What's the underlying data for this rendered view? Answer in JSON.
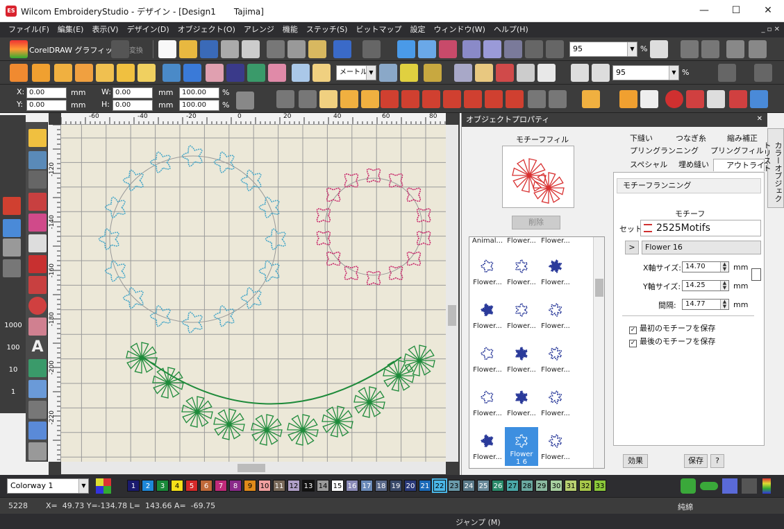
{
  "window": {
    "title": "Wilcom EmbroideryStudio - デザイン - [Design1",
    "machine": "Tajima]",
    "min": "—",
    "max": "☐",
    "close": "✕"
  },
  "menu": [
    "ファイル(F)",
    "編集(E)",
    "表示(V)",
    "デザイン(D)",
    "オブジェクト(O)",
    "アレンジ",
    "機能",
    "ステッチ(S)",
    "ビットマップ",
    "設定",
    "ウィンドウ(W)",
    "ヘルプ(H)"
  ],
  "menu_right": "_ ▫ ✕",
  "toolbar1": {
    "coreldraw_label": "CorelDRAW グラフィック",
    "convert_label": "変換",
    "zoom_value": "95",
    "zoom_unit": "%"
  },
  "toolbar2": {
    "method_combo": "メートル法",
    "zoom2_value": "95",
    "zoom2_unit": "%"
  },
  "toolbar3": {
    "x_label": "X:",
    "x_value": "0.00",
    "y_label": "Y:",
    "y_value": "0.00",
    "w_label": "W:",
    "w_value": "0.00",
    "h_label": "H:",
    "h_value": "0.00",
    "unit": "mm",
    "scale_w": "100.00",
    "scale_h": "100.00",
    "pct": "%"
  },
  "ruler": {
    "top": [
      "-60",
      "-40",
      "-20",
      "0",
      "20",
      "40",
      "60",
      "80"
    ],
    "left": [
      "-120",
      "-140",
      "-160",
      "-180",
      "-200",
      "-220"
    ]
  },
  "left_tools": {
    "labels": [
      "1000",
      "100",
      "10",
      "1"
    ]
  },
  "props": {
    "title": "オブジェクトプロパティ",
    "preview_label": "モチーフフィル",
    "delete_button": "削除",
    "tabs": [
      "下縫い",
      "つなぎ糸",
      "縮み補正",
      "プリングランニング",
      "プリングフィル",
      "スペシャル",
      "埋め縫い",
      "アウトライン"
    ],
    "section_title": "モチーフランニング",
    "motif_heading": "モチーフ",
    "set_label": "セット:",
    "set_value": "2525Motifs",
    "expand": ">",
    "motif_value": "Flower 16",
    "x_size_label": "X軸サイズ:",
    "x_size": "14.70",
    "y_size_label": "Y軸サイズ:",
    "y_size": "14.25",
    "spacing_label": "間隔:",
    "spacing": "14.77",
    "unit": "mm",
    "keep_first": "最初のモチーフを保存",
    "keep_last": "最後のモチーフを保存",
    "effects_button": "効果",
    "save_button": "保存",
    "help_button": "?",
    "side_tab": "カラーオブジェクトリスト",
    "gallery_top": [
      "Animal...",
      "Flower...",
      "Flower..."
    ],
    "gallery": [
      "Flower...",
      "Flower...",
      "Flower...",
      "Flower...",
      "Flower...",
      "Flower...",
      "Flower...",
      "Flower...",
      "Flower...",
      "Flower...",
      "Flower...",
      "Flower...",
      "Flower...",
      "Flower 1 6",
      "Flower..."
    ]
  },
  "palette": {
    "colorway": "Colorway 1",
    "swatches": [
      {
        "n": "1",
        "c": "#1a1a6e",
        "t": "#fff"
      },
      {
        "n": "2",
        "c": "#1e88d8",
        "t": "#fff"
      },
      {
        "n": "3",
        "c": "#1a8a3a",
        "t": "#fff"
      },
      {
        "n": "4",
        "c": "#f4e01a",
        "t": "#000"
      },
      {
        "n": "5",
        "c": "#d42a2a",
        "t": "#fff"
      },
      {
        "n": "6",
        "c": "#c06a3a",
        "t": "#fff"
      },
      {
        "n": "7",
        "c": "#c02a7a",
        "t": "#fff"
      },
      {
        "n": "8",
        "c": "#8a2a8a",
        "t": "#fff"
      },
      {
        "n": "9",
        "c": "#e08a1a",
        "t": "#000"
      },
      {
        "n": "10",
        "c": "#f0a0a0",
        "t": "#000"
      },
      {
        "n": "11",
        "c": "#7a6a5a",
        "t": "#fff"
      },
      {
        "n": "12",
        "c": "#b0a0c8",
        "t": "#000"
      },
      {
        "n": "13",
        "c": "#111111",
        "t": "#fff"
      },
      {
        "n": "14",
        "c": "#9a9a9a",
        "t": "#000"
      },
      {
        "n": "15",
        "c": "#ffffff",
        "t": "#000"
      },
      {
        "n": "16",
        "c": "#8a8ab8",
        "t": "#fff"
      },
      {
        "n": "17",
        "c": "#6a8ab8",
        "t": "#fff"
      },
      {
        "n": "18",
        "c": "#5a6a8a",
        "t": "#fff"
      },
      {
        "n": "19",
        "c": "#3a4a6a",
        "t": "#fff"
      },
      {
        "n": "20",
        "c": "#2a3a7a",
        "t": "#fff"
      },
      {
        "n": "21",
        "c": "#1a6ab8",
        "t": "#fff"
      },
      {
        "n": "22",
        "c": "#4ab8e8",
        "t": "#000"
      },
      {
        "n": "23",
        "c": "#6a9aaa",
        "t": "#000"
      },
      {
        "n": "24",
        "c": "#5a7a8a",
        "t": "#fff"
      },
      {
        "n": "25",
        "c": "#6a8a9a",
        "t": "#fff"
      },
      {
        "n": "26",
        "c": "#2a8a6a",
        "t": "#fff"
      },
      {
        "n": "27",
        "c": "#4aa8a8",
        "t": "#000"
      },
      {
        "n": "28",
        "c": "#6aa8a0",
        "t": "#000"
      },
      {
        "n": "29",
        "c": "#8ab8a0",
        "t": "#000"
      },
      {
        "n": "30",
        "c": "#a8d0a0",
        "t": "#000"
      },
      {
        "n": "31",
        "c": "#b8d070",
        "t": "#000"
      },
      {
        "n": "32",
        "c": "#a8c84a",
        "t": "#000"
      },
      {
        "n": "33",
        "c": "#8ac83a",
        "t": "#000"
      }
    ]
  },
  "status": {
    "stitch_count": "5228",
    "coords": "X=  49.73 Y=-134.78 L=  143.66 A=  -69.75",
    "fabric": "純綿",
    "jump": "ジャンプ (M)"
  },
  "colors": {
    "blue_motif": "#4aa8c8",
    "pink_motif": "#c8286a",
    "green_motif": "#1e8a3a"
  }
}
